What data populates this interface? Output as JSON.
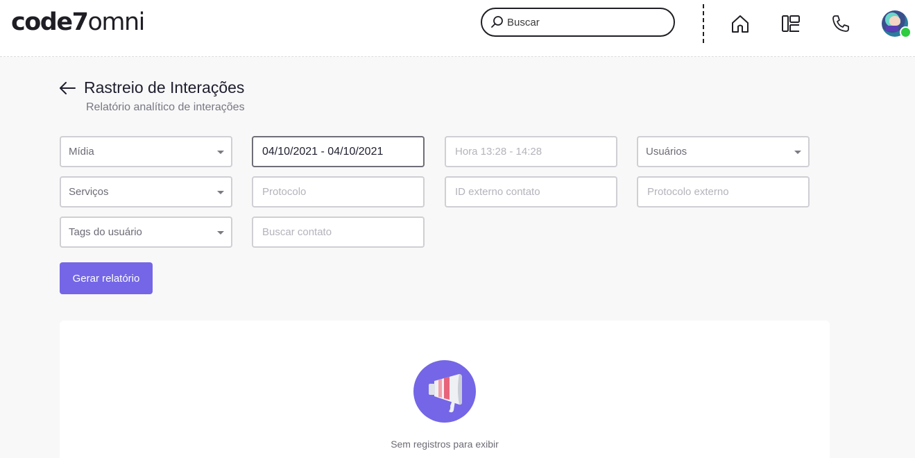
{
  "header": {
    "logo_bold": "code7",
    "logo_light": "omni",
    "search_placeholder": "Buscar",
    "icons": [
      "search-icon",
      "home-icon",
      "layout-icon",
      "phone-icon"
    ]
  },
  "page": {
    "title": "Rastreio de Interações",
    "subtitle": "Relatório analítico de interações"
  },
  "filters": {
    "midia": "Mídia",
    "date_range": "04/10/2021 - 04/10/2021",
    "hora": "Hora 13:28 - 14:28",
    "usuarios": "Usuários",
    "servicos": "Serviços",
    "protocolo": "Protocolo",
    "id_externo": "ID externo contato",
    "protocolo_externo": "Protocolo externo",
    "tags_usuario": "Tags do usuário",
    "buscar_contato": "Buscar contato"
  },
  "actions": {
    "generate_report": "Gerar relatório"
  },
  "empty_state": {
    "message": "Sem registros para exibir",
    "icon": "megaphone-icon"
  },
  "colors": {
    "primary": "#7466e6",
    "status_online": "#2ecc40",
    "background": "#f8f8f8"
  }
}
